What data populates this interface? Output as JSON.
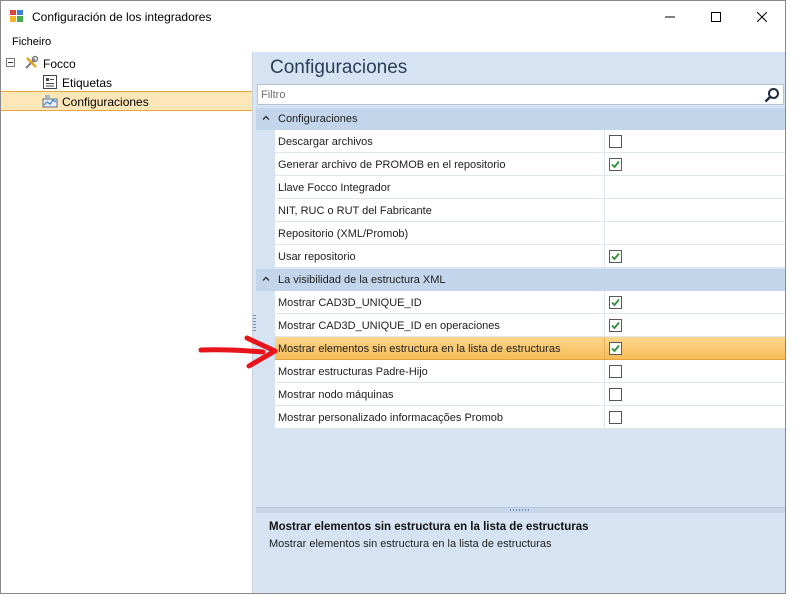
{
  "window": {
    "title": "Configuración de los integradores",
    "controls": {
      "minimize": "minimize-icon",
      "maximize": "maximize-icon",
      "close": "close-icon"
    }
  },
  "menu": {
    "items": [
      {
        "label": "Ficheiro"
      }
    ]
  },
  "tree": {
    "root": {
      "label": "Focco",
      "icon": "tools-icon",
      "expanded": true
    },
    "children": [
      {
        "label": "Etiquetas",
        "icon": "label-icon",
        "selected": false
      },
      {
        "label": "Configuraciones",
        "icon": "settings-chart-icon",
        "selected": true
      }
    ]
  },
  "main": {
    "title": "Configuraciones",
    "filter": {
      "placeholder": "Filtro",
      "value": ""
    },
    "categories": [
      {
        "label": "Configuraciones",
        "rows": [
          {
            "name": "Descargar archivos",
            "type": "checkbox",
            "checked": false
          },
          {
            "name": "Generar archivo de PROMOB en el repositorio",
            "type": "checkbox",
            "checked": true
          },
          {
            "name": "Llave Focco Integrador",
            "type": "text",
            "value": ""
          },
          {
            "name": "NIT, RUC o RUT del Fabricante",
            "type": "text",
            "value": ""
          },
          {
            "name": "Repositorio (XML/Promob)",
            "type": "text",
            "value": ""
          },
          {
            "name": "Usar repositorio",
            "type": "checkbox",
            "checked": true
          }
        ]
      },
      {
        "label": "La visibilidad de la estructura XML",
        "rows": [
          {
            "name": "Mostrar CAD3D_UNIQUE_ID",
            "type": "checkbox",
            "checked": true
          },
          {
            "name": "Mostrar CAD3D_UNIQUE_ID en operaciones",
            "type": "checkbox",
            "checked": true
          },
          {
            "name": "Mostrar elementos sin estructura en la lista de estructuras",
            "type": "checkbox",
            "checked": true,
            "selected": true
          },
          {
            "name": "Mostrar estructuras Padre-Hijo",
            "type": "checkbox",
            "checked": false
          },
          {
            "name": "Mostrar nodo máquinas",
            "type": "checkbox",
            "checked": false
          },
          {
            "name": "Mostrar personalizado informacações Promob",
            "type": "checkbox",
            "checked": false
          }
        ]
      }
    ],
    "description": {
      "title": "Mostrar elementos sin estructura en la lista de estructuras",
      "text": "Mostrar elementos sin estructura en la lista de estructuras"
    }
  },
  "colors": {
    "selection_fill": "#f7bc58",
    "panel_bg": "#d6e3f2",
    "category_bg": "#c3d5ea",
    "check_green": "#2f8f3a",
    "annotation_arrow": "#e8141b"
  }
}
